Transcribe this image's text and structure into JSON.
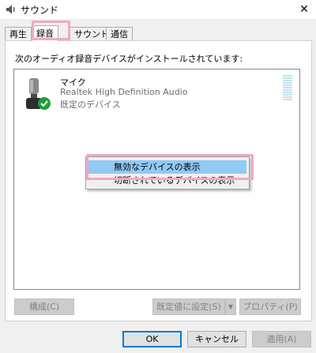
{
  "window": {
    "title": "サウンド",
    "close_glyph": "✕"
  },
  "tabs": [
    {
      "label": "再生",
      "active": false
    },
    {
      "label": "録音",
      "active": true
    },
    {
      "label": "サウンド",
      "active": false
    },
    {
      "label": "通信",
      "active": false
    }
  ],
  "panel": {
    "instruction": "次のオーディオ録音デバイスがインストールされています:",
    "device": {
      "name": "マイク",
      "driver": "Realtek High Definition Audio",
      "status": "既定のデバイス",
      "icon": "microphone-icon",
      "badge_icon": "default-checkmark-icon"
    },
    "context_menu": [
      {
        "label": "無効なデバイスの表示",
        "hovered": true
      },
      {
        "label": "切断されているデバイスの表示",
        "hovered": false
      }
    ],
    "buttons": {
      "configure": "構成(C)",
      "set_default": "既定値に設定(S)",
      "properties": "プロパティ(P)"
    }
  },
  "footer": {
    "ok": "OK",
    "cancel": "キャンセル",
    "apply": "適用(A)"
  },
  "colors": {
    "accent": "#0078d7",
    "annotation": "#f2a7c7",
    "menu_hover": "#91c9f7",
    "check_green": "#1e9e3a"
  }
}
